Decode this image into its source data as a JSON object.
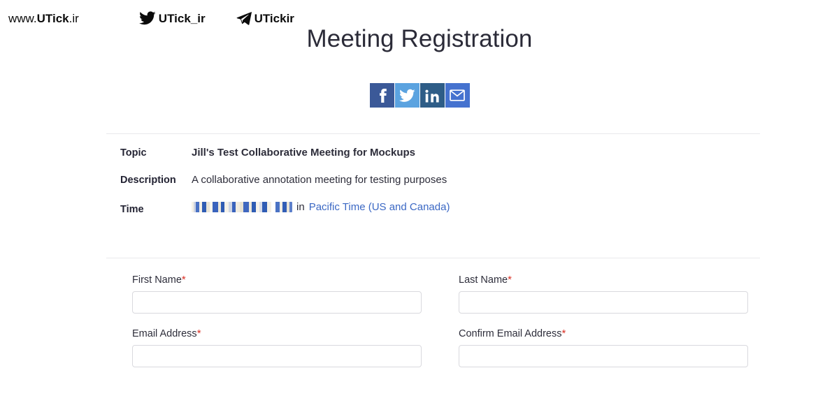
{
  "watermark": {
    "site": {
      "prefix": "www.",
      "brand": "UTick",
      "suffix": ".ir"
    },
    "twitter": {
      "icon": "twitter-bird-icon",
      "handle": "UTick_ir"
    },
    "telegram": {
      "icon": "telegram-plane-icon",
      "handle": "UTickir"
    }
  },
  "page": {
    "title": "Meeting Registration"
  },
  "share": {
    "buttons": [
      {
        "name": "facebook",
        "label": "f",
        "icon": "facebook-icon",
        "color": "#3b5998"
      },
      {
        "name": "twitter",
        "label": "",
        "icon": "twitter-icon",
        "color": "#5ba3e0"
      },
      {
        "name": "linkedin",
        "label": "in",
        "icon": "linkedin-icon",
        "color": "#2e5d87"
      },
      {
        "name": "email",
        "label": "",
        "icon": "envelope-icon",
        "color": "#4572cf"
      }
    ]
  },
  "meeting": {
    "topic_label": "Topic",
    "topic_value": "Jill's Test Collaborative Meeting for Mockups",
    "description_label": "Description",
    "description_value": "A collaborative annotation meeting for testing purposes",
    "time_label": "Time",
    "time_value_redacted": "",
    "time_joiner": "in",
    "timezone": "Pacific Time (US and Canada)",
    "timezone_color": "#3b68c4"
  },
  "form": {
    "required_marker": "*",
    "rows": [
      [
        {
          "name": "first-name",
          "label": "First Name",
          "required": true,
          "value": "",
          "placeholder": ""
        },
        {
          "name": "last-name",
          "label": "Last Name",
          "required": true,
          "value": "",
          "placeholder": ""
        }
      ],
      [
        {
          "name": "email-address",
          "label": "Email Address",
          "required": true,
          "value": "",
          "placeholder": ""
        },
        {
          "name": "confirm-email-address",
          "label": "Confirm Email Address",
          "required": true,
          "value": "",
          "placeholder": ""
        }
      ]
    ]
  }
}
